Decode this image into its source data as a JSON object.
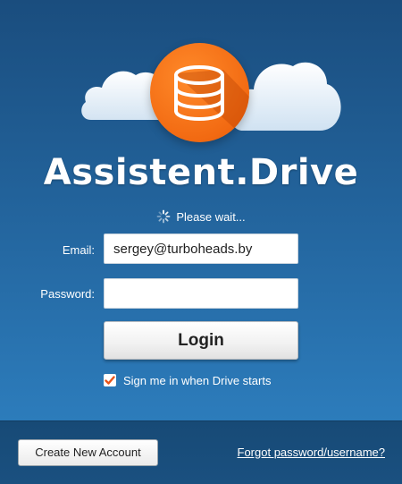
{
  "app": {
    "title": "Assistent.Drive",
    "logo_icon": "database-icon",
    "accent_color": "#f26a12"
  },
  "status": {
    "text": "Please wait...",
    "icon": "spinner-icon"
  },
  "form": {
    "email_label": "Email:",
    "email_value": "sergey@turboheads.by",
    "password_label": "Password:",
    "password_value": "",
    "login_label": "Login",
    "remember_label": "Sign me in when Drive starts",
    "remember_checked": true
  },
  "footer": {
    "create_account_label": "Create New Account",
    "forgot_label": "Forgot password/username?"
  }
}
